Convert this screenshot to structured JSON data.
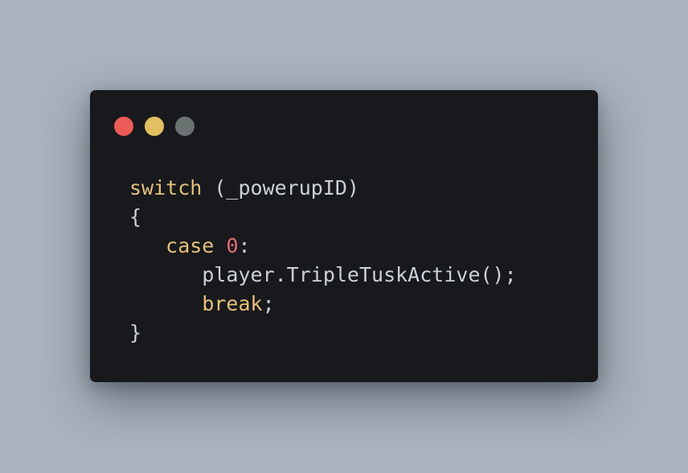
{
  "window": {
    "dots": [
      {
        "name": "close",
        "color": "#ec5b56"
      },
      {
        "name": "minimize",
        "color": "#e2bf61"
      },
      {
        "name": "zoom",
        "color": "#6b7272"
      }
    ]
  },
  "code": {
    "lines": [
      {
        "indent": "",
        "tokens": [
          {
            "type": "keyword",
            "text": "switch"
          },
          {
            "type": "plain",
            "text": " (_powerupID)"
          }
        ]
      },
      {
        "indent": "",
        "tokens": [
          {
            "type": "plain",
            "text": "{"
          }
        ]
      },
      {
        "indent": "   ",
        "tokens": [
          {
            "type": "keyword",
            "text": "case"
          },
          {
            "type": "plain",
            "text": " "
          },
          {
            "type": "number",
            "text": "0"
          },
          {
            "type": "plain",
            "text": ":"
          }
        ]
      },
      {
        "indent": "      ",
        "tokens": [
          {
            "type": "plain",
            "text": "player.TripleTuskActive();"
          }
        ]
      },
      {
        "indent": "      ",
        "tokens": [
          {
            "type": "keyword",
            "text": "break"
          },
          {
            "type": "plain",
            "text": ";"
          }
        ]
      },
      {
        "indent": "",
        "tokens": [
          {
            "type": "plain",
            "text": "}"
          }
        ]
      }
    ]
  }
}
